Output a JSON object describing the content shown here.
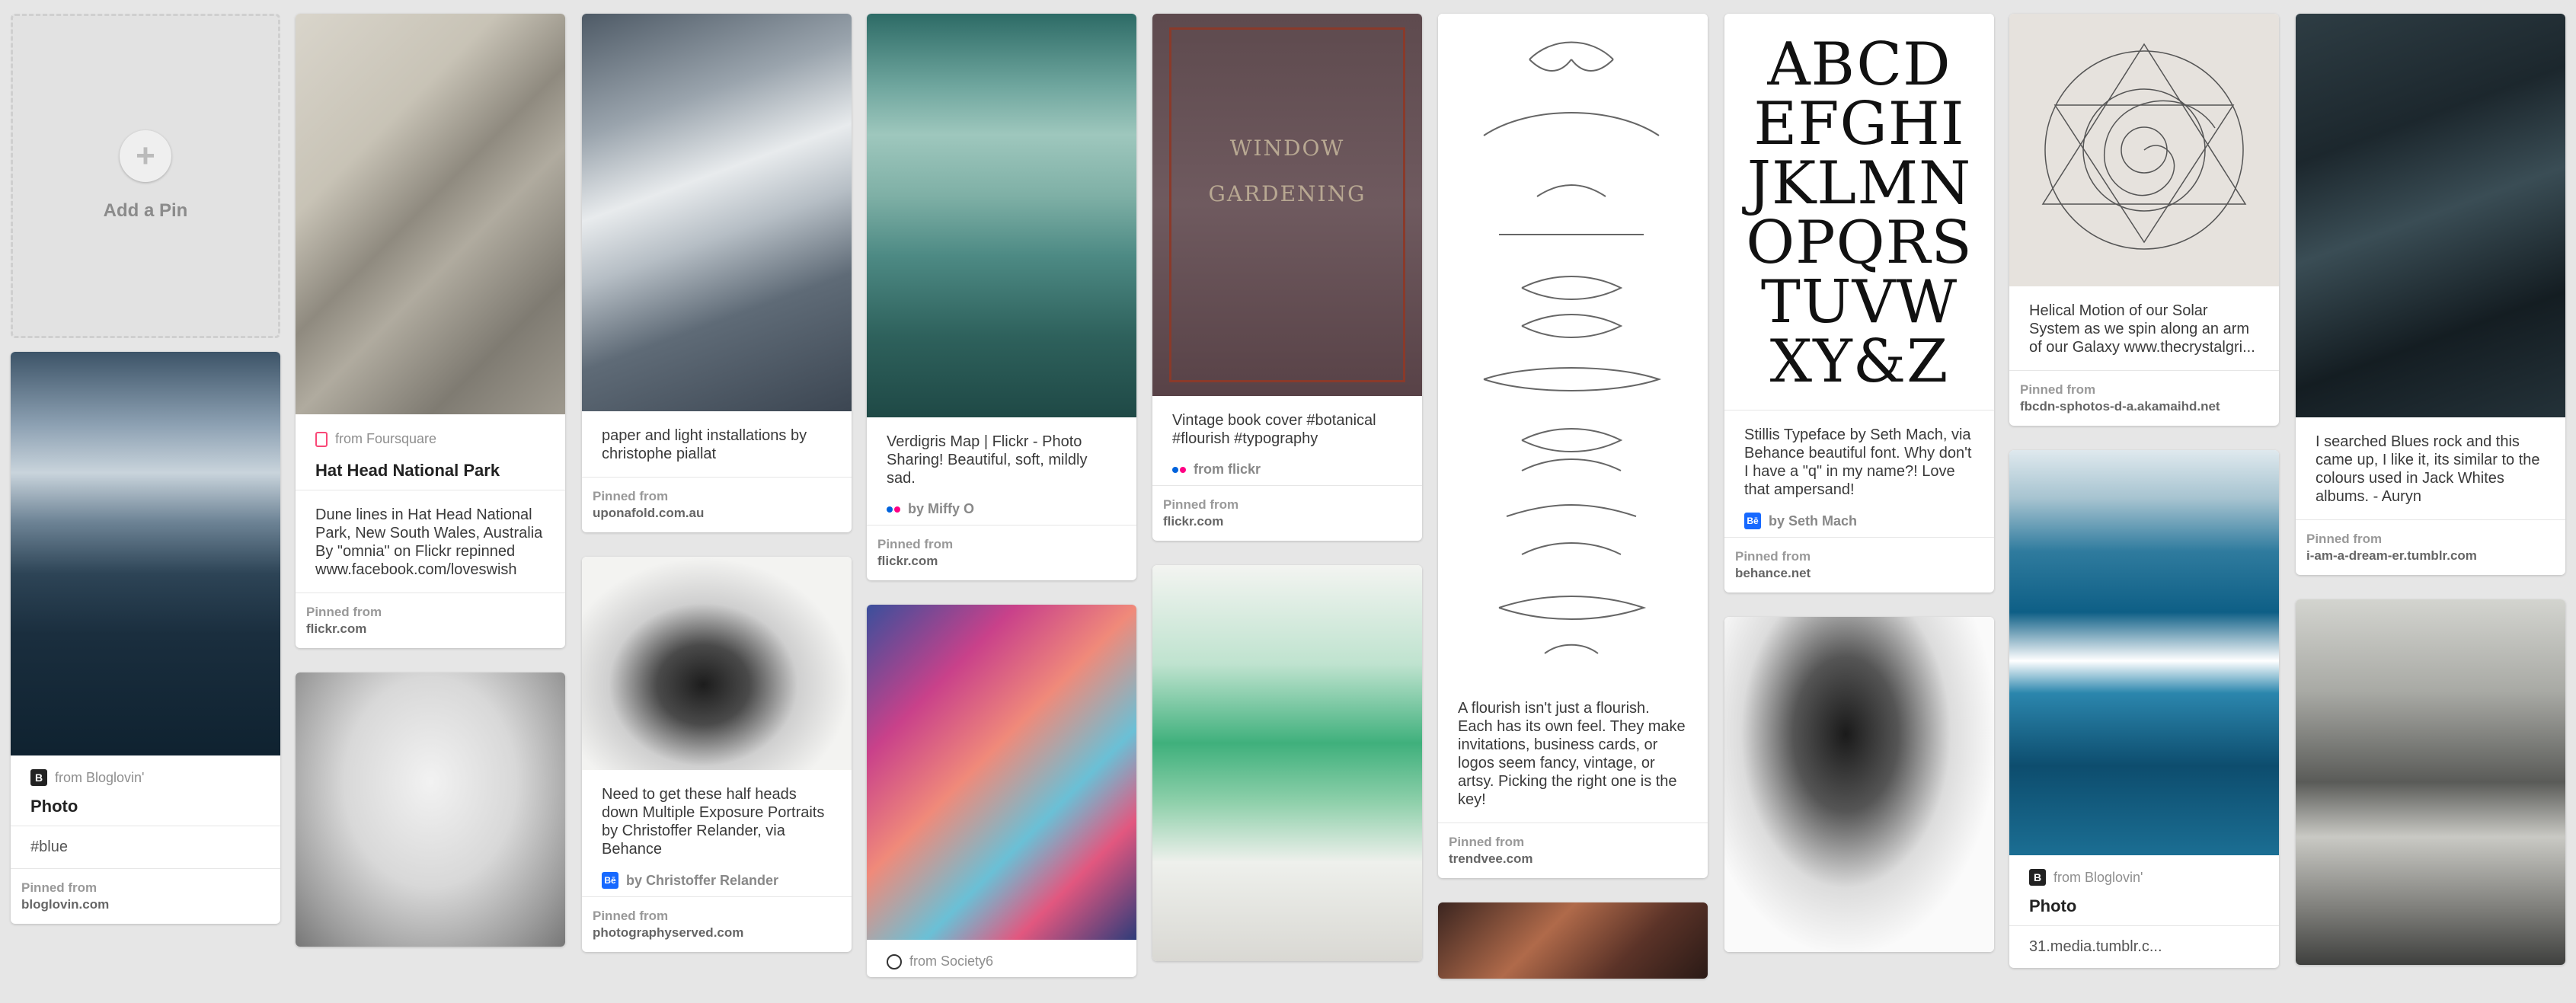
{
  "add_pin": {
    "label": "Add a Pin",
    "plus": "+"
  },
  "pins": {
    "storm": {
      "source_via": "from Bloglovin'",
      "title": "Photo",
      "tag": "#blue",
      "pinned_label": "Pinned from",
      "domain": "bloglovin.com",
      "icon": "bloglovin-icon"
    },
    "dune": {
      "source_via": "from Foursquare",
      "title": "Hat Head National Park",
      "desc": "Dune lines in Hat Head National Park, New South Wales, Australia By \"omnia\" on Flickr repinned www.facebook.com/loveswish",
      "pinned_label": "Pinned from",
      "domain": "flickr.com",
      "icon": "foursquare-icon"
    },
    "paper": {
      "desc": "paper and light installations by christophe piallat",
      "pinned_label": "Pinned from",
      "domain": "uponafold.com.au"
    },
    "halfhead": {
      "desc": "Need to get these half heads down Multiple Exposure Portraits by Christoffer Relander, via Behance",
      "by": "by Christoffer Relander",
      "pinned_label": "Pinned from",
      "domain": "photographyserved.com",
      "icon": "behance-icon"
    },
    "verdigris": {
      "desc": "Verdigris Map | Flickr - Photo Sharing! Beautiful, soft, mildly sad.",
      "by": "by Miffy O",
      "pinned_label": "Pinned from",
      "domain": "flickr.com",
      "icon": "flickr-icon"
    },
    "society6": {
      "source_via": "from Society6",
      "icon": "society6-icon"
    },
    "book": {
      "desc": "Vintage book cover #botanical #flourish #typography",
      "by": "from flickr",
      "pinned_label": "Pinned from",
      "domain": "flickr.com",
      "icon": "flickr-icon",
      "cover_text_1": "WINDOW",
      "cover_text_2": "GARDENING"
    },
    "flourish": {
      "desc": "A flourish isn't just a flourish. Each has its own feel. They make invitations, business cards, or logos seem fancy, vintage, or artsy. Picking the right one is the key!",
      "pinned_label": "Pinned from",
      "domain": "trendvee.com"
    },
    "typeface": {
      "letters": [
        "ABCD",
        "EFGHI",
        "JKLMN",
        "OPQRS",
        "TUVW",
        "XY&Z"
      ],
      "desc": "Stillis Typeface by Seth Mach, via Behance beautiful font. Why don't I have a \"q\" in my name?! Love that ampersand!",
      "by": "by Seth Mach",
      "pinned_label": "Pinned from",
      "domain": "behance.net",
      "icon": "behance-icon"
    },
    "helical": {
      "desc": "Helical Motion of our Solar System as we spin along an arm of our Galaxy www.thecrystalgri...",
      "pinned_label": "Pinned from",
      "domain": "fbcdn-sphotos-d-a.akamaihd.net"
    },
    "wave": {
      "source_via": "from Bloglovin'",
      "title": "Photo",
      "tag": "31.media.tumblr.c...",
      "icon": "bloglovin-icon"
    },
    "blues": {
      "desc": "I searched Blues rock and this came up, I like it, its similar to the colours used in Jack Whites albums. - Auryn",
      "pinned_label": "Pinned from",
      "domain": "i-am-a-dream-er.tumblr.com"
    }
  },
  "colors": {
    "background": "#e6e6e6",
    "card": "#ffffff",
    "bloglovin": "#222222",
    "foursquare": "#f94877",
    "behance": "#1769ff",
    "flickr_blue": "#0063dc",
    "flickr_pink": "#ff0084"
  }
}
